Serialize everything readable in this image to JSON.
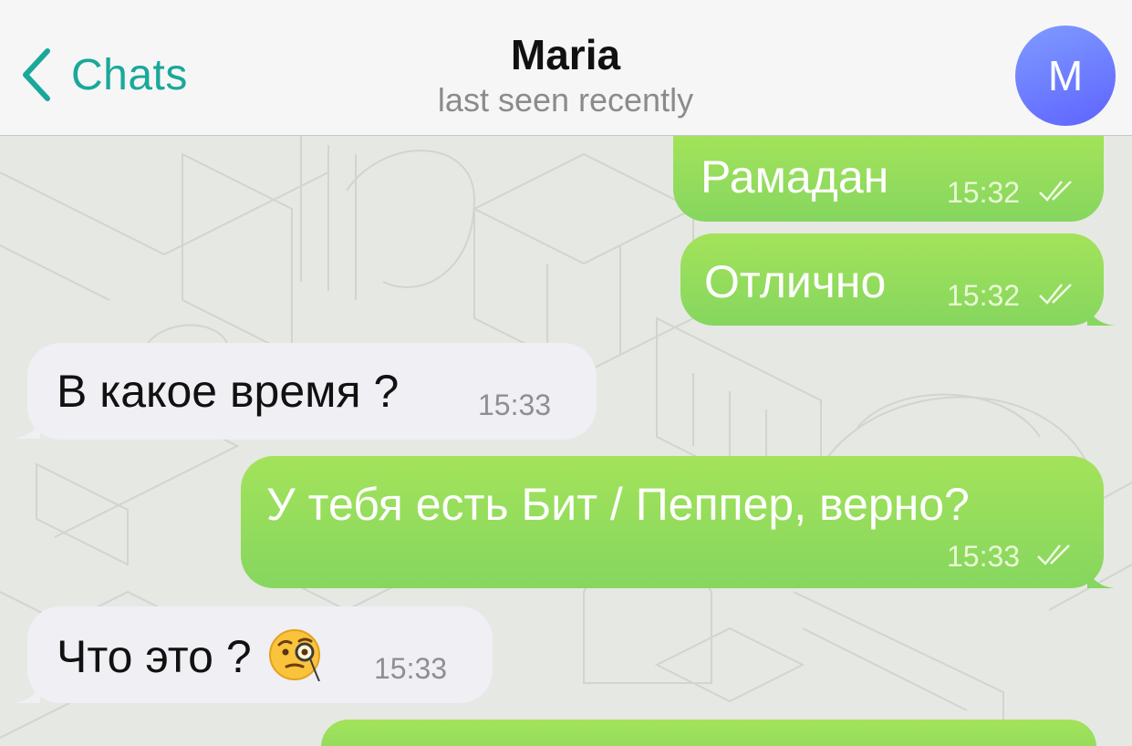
{
  "header": {
    "back_label": "Chats",
    "title": "Maria",
    "subtitle": "last seen recently",
    "avatar_initial": "M"
  },
  "messages": [
    {
      "direction": "out",
      "text": "Рамадан",
      "time": "15:32",
      "status": "read"
    },
    {
      "direction": "out",
      "text": "Отлично",
      "time": "15:32",
      "status": "read"
    },
    {
      "direction": "in",
      "text": "В какое время ?",
      "time": "15:33"
    },
    {
      "direction": "out",
      "text": "У тебя есть Бит / Пеппер, верно?",
      "time": "15:33",
      "status": "read"
    },
    {
      "direction": "in",
      "text": "Что это ?",
      "emoji": "face-with-monocle",
      "time": "15:33"
    }
  ],
  "colors": {
    "accent": "#1aa89a",
    "outgoing_bubble": "#8fd95c",
    "incoming_bubble": "#efeff4",
    "avatar_start": "#7f9bff",
    "avatar_end": "#5e64ff"
  }
}
